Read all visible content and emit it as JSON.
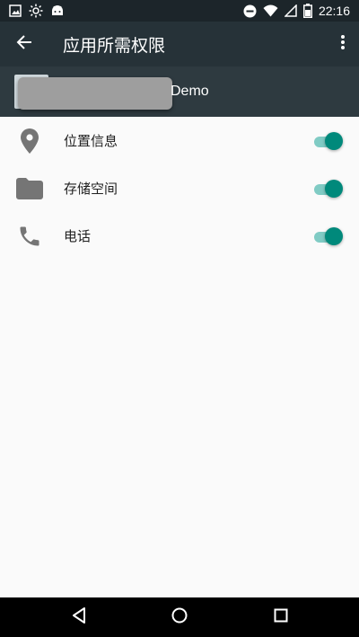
{
  "status_bar": {
    "left_icons": [
      "image-icon",
      "brightness-icon",
      "android-icon"
    ],
    "right_icons": [
      "do-not-disturb-icon",
      "wifi-icon",
      "signal-icon",
      "battery-icon"
    ],
    "time": "22:16"
  },
  "app_bar": {
    "title": "应用所需权限",
    "back_icon": "arrow-back-icon",
    "more_icon": "more-vert-icon"
  },
  "app_header": {
    "app_name_visible": "Demo"
  },
  "permissions": [
    {
      "label": "位置信息",
      "icon": "location-icon",
      "enabled": true
    },
    {
      "label": "存储空间",
      "icon": "folder-icon",
      "enabled": true
    },
    {
      "label": "电话",
      "icon": "phone-icon",
      "enabled": true
    }
  ],
  "colors": {
    "status_bar": "#1c252a",
    "app_bar": "#263238",
    "app_header": "#2e3a40",
    "switch_thumb": "#00897b",
    "switch_track": "#80cbc4",
    "background": "#fafafa"
  },
  "nav_bar": {
    "icons": [
      "back-triangle-icon",
      "home-circle-icon",
      "recents-square-icon"
    ]
  }
}
